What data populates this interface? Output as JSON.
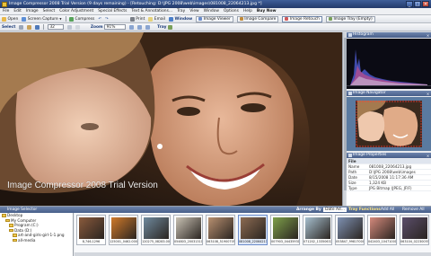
{
  "window": {
    "title": "Image Compressor 2008 Trial Version (9 days remaining) - [Retouching: D:\\JPG 2008\\web\\images\\081008_22064213.jpg *]",
    "minimize": "_",
    "maximize": "□",
    "close": "×"
  },
  "menu": [
    "File",
    "Edit",
    "Image",
    "Select",
    "Color Adjustment",
    "Special Effects",
    "Text & Annotations...",
    "Tray",
    "View",
    "Window",
    "Options",
    "Help",
    "Buy Now"
  ],
  "toolbar1": {
    "open": "Open",
    "screen_capture": "Screen Capture",
    "compress": "Compress",
    "print": "Print",
    "email": "Email",
    "window": "Window",
    "tabs": [
      "Image Viewer",
      "Image Compare",
      "Image Retouch",
      "Image Tray (Empty)"
    ],
    "active_tab": "Image Retouch"
  },
  "toolbar2": {
    "select": "Select",
    "font_size": "32",
    "zoom_label": "Zoom",
    "zoom_value": "91%",
    "tray": "Tray"
  },
  "main": {
    "watermark": "Image Compressor 2008 Trial Version"
  },
  "panels": {
    "histogram": "Histogram",
    "navigator": "Image Navigator",
    "properties": "Image Properties",
    "props_section": "File",
    "props": [
      {
        "k": "Name",
        "v": "081008_22064213.jpg"
      },
      {
        "k": "Path",
        "v": "D:\\JPG 2008\\web\\images"
      },
      {
        "k": "Date",
        "v": "8/15/2008 11:17:36 AM"
      },
      {
        "k": "Size",
        "v": "1,324 KB"
      },
      {
        "k": "Type",
        "v": "JPG Bitmap (JPEG, JFIF)"
      }
    ]
  },
  "selector": {
    "title": "Image Selector",
    "arrange_label": "Arrange By",
    "arrange_value": "Date Ad...",
    "tray_functions": "Tray Functions",
    "add_all": "Add All",
    "remove_all": "Remove All",
    "tree": [
      {
        "label": "Desktop",
        "indent": 0
      },
      {
        "label": "My Computer",
        "indent": 1
      },
      {
        "label": "Program (C:)",
        "indent": 2
      },
      {
        "label": "Data (D:)",
        "indent": 2
      },
      {
        "label": "art-and-girls-girl-1-1.png",
        "indent": 3
      },
      {
        "label": "all-media",
        "indent": 3
      }
    ],
    "thumbs": [
      {
        "cap": "8,746,1296",
        "color": "#8a5a3c",
        "sel": false
      },
      {
        "cap": "125001_0462.000",
        "color": "#d07a2a",
        "sel": false
      },
      {
        "cap": "120275_08283.00",
        "color": "#6f8a9e",
        "sel": false
      },
      {
        "cap": "054803_20031311",
        "color": "#c9c2b4",
        "sel": false
      },
      {
        "cap": "063108_51900705",
        "color": "#b89070",
        "sel": false
      },
      {
        "cap": "081008_22064213",
        "color": "#8c6b52",
        "sel": true
      },
      {
        "cap": "007903_04435931",
        "color": "#7ea04a",
        "sel": false
      },
      {
        "cap": "071202_13350637",
        "color": "#a7c0cf",
        "sel": false
      },
      {
        "cap": "053847_99817000",
        "color": "#7e91b2",
        "sel": false
      },
      {
        "cap": "042403_10471001",
        "color": "#d48a7c",
        "sel": false
      },
      {
        "cap": "063104_02230055",
        "color": "#5b4e6b",
        "sel": false
      }
    ]
  },
  "colors": {
    "title_bar": "#2e4a80",
    "panel_header": "#5a719c",
    "accent": "#6b8ccb"
  }
}
